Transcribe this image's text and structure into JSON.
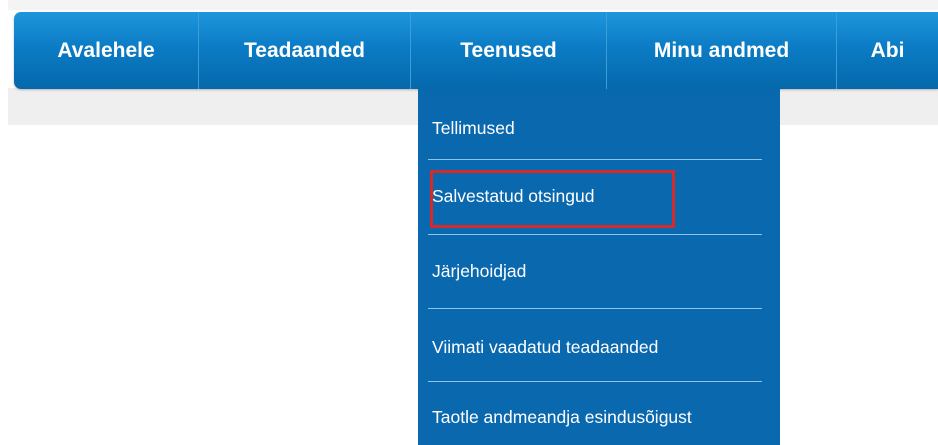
{
  "nav": {
    "items": [
      {
        "label": "Avalehele"
      },
      {
        "label": "Teadaanded"
      },
      {
        "label": "Teenused"
      },
      {
        "label": "Minu andmed"
      },
      {
        "label": "Abi"
      }
    ]
  },
  "dropdown": {
    "parent": "Teenused",
    "items": [
      {
        "label": "Tellimused"
      },
      {
        "label": "Salvestatud otsingud",
        "highlighted": true
      },
      {
        "label": "Järjehoidjad"
      },
      {
        "label": "Viimati vaadatud teadaanded"
      },
      {
        "label": "Taotle andmeandja esindusõigust"
      }
    ]
  },
  "colors": {
    "nav_top": "#1e96dc",
    "nav_bottom": "#0568ab",
    "dropdown_bg": "#0a68ae",
    "separator": "#8fc4ea",
    "highlight_border": "#d42a2a"
  }
}
